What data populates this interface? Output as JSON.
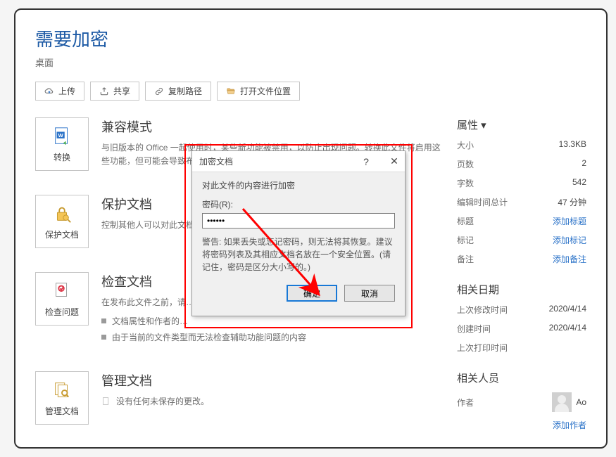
{
  "page": {
    "title": "需要加密",
    "subtitle": "桌面"
  },
  "toolbar": {
    "upload": "上传",
    "share": "共享",
    "copypath": "复制路径",
    "openloc": "打开文件位置"
  },
  "sections": {
    "compat": {
      "btn": "转换",
      "title": "兼容模式",
      "desc": "与旧版本的 Office 一起使用时，某些新功能被禁用，以防止出现问题。转换此文件将启用这些功能，但可能会导致布局更改。"
    },
    "protect": {
      "btn": "保护文档",
      "title": "保护文档",
      "desc": "控制其他人可以对此文档…"
    },
    "inspect": {
      "btn": "检查问题",
      "title": "检查文档",
      "desc": "在发布此文件之前，请…",
      "b1": "文档属性和作者的…",
      "b2": "由于当前的文件类型而无法检查辅助功能问题的内容"
    },
    "manage": {
      "btn": "管理文档",
      "title": "管理文档",
      "b1": "没有任何未保存的更改。"
    }
  },
  "props": {
    "heading": "属性 ▾",
    "size_k": "大小",
    "size_v": "13.3KB",
    "pages_k": "页数",
    "pages_v": "2",
    "words_k": "字数",
    "words_v": "542",
    "edit_k": "编辑时间总计",
    "edit_v": "47 分钟",
    "title_k": "标题",
    "title_v": "添加标题",
    "tag_k": "标记",
    "tag_v": "添加标记",
    "remark_k": "备注",
    "remark_v": "添加备注",
    "dates_heading": "相关日期",
    "mod_k": "上次修改时间",
    "mod_v": "2020/4/14",
    "create_k": "创建时间",
    "create_v": "2020/4/14",
    "print_k": "上次打印时间",
    "print_v": "",
    "people_heading": "相关人员",
    "author_k": "作者",
    "author_v": "Ao",
    "addauthor": "添加作者"
  },
  "dialog": {
    "title": "加密文档",
    "heading": "对此文件的内容进行加密",
    "label": "密码(R):",
    "value": "••••••",
    "warning": "警告: 如果丢失或忘记密码，则无法将其恢复。建议将密码列表及其相应文档名放在一个安全位置。(请记住，密码是区分大小写的。)",
    "ok": "确定",
    "cancel": "取消"
  }
}
